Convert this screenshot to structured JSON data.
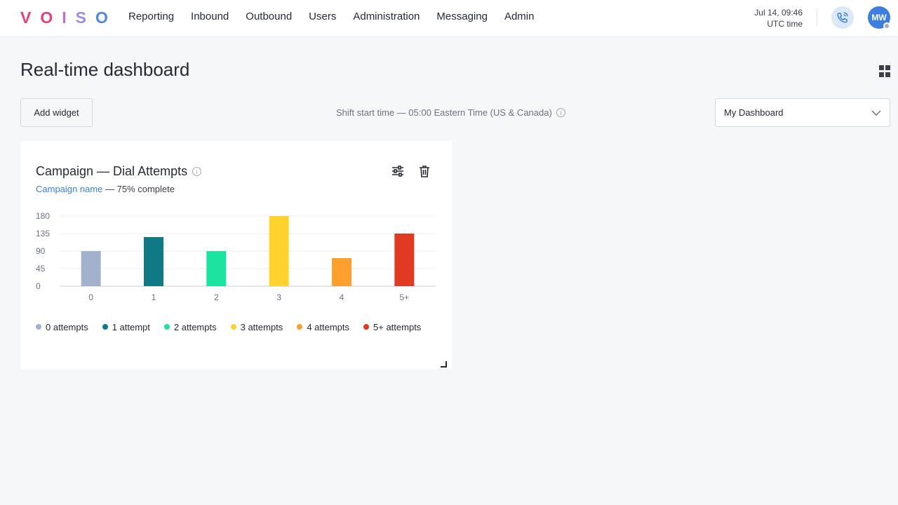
{
  "brand": {
    "letters": [
      "V",
      "O",
      "I",
      "S",
      "O"
    ],
    "colors": [
      "#e8407a",
      "#e8407a",
      "#c470c8",
      "#9b8ee0",
      "#4f86e8"
    ]
  },
  "nav": {
    "items": [
      {
        "label": "Reporting",
        "active": true
      },
      {
        "label": "Inbound"
      },
      {
        "label": "Outbound"
      },
      {
        "label": "Users"
      },
      {
        "label": "Administration"
      },
      {
        "label": "Messaging"
      },
      {
        "label": "Admin"
      }
    ]
  },
  "clock": {
    "datetime": "Jul 14, 09:46",
    "zone": "UTC time"
  },
  "user": {
    "initials": "MW"
  },
  "page": {
    "title": "Real-time dashboard"
  },
  "toolbar": {
    "add_widget_label": "Add widget",
    "shift_text": "Shift start time — 05:00 Eastern Time (US & Canada)",
    "dashboard_selected": "My Dashboard"
  },
  "widget": {
    "title": "Campaign — Dial Attempts",
    "subtitle_link": "Campaign name",
    "subtitle_rest": " — 75% complete"
  },
  "chart_data": {
    "type": "bar",
    "categories": [
      "0",
      "1",
      "2",
      "3",
      "4",
      "5+"
    ],
    "values": [
      90,
      126,
      90,
      180,
      72,
      135
    ],
    "colors": [
      "#a2b1cc",
      "#0f7a85",
      "#1be3a0",
      "#ffd22e",
      "#ff9f2e",
      "#e03a23"
    ],
    "yticks": [
      0,
      45,
      90,
      135,
      180
    ],
    "ylim": [
      0,
      180
    ],
    "grid": true,
    "legend": [
      "0 attempts",
      "1 attempt",
      "2 attempts",
      "3 attempts",
      "4 attempts",
      "5+ attempts"
    ],
    "legend_position": "bottom"
  }
}
